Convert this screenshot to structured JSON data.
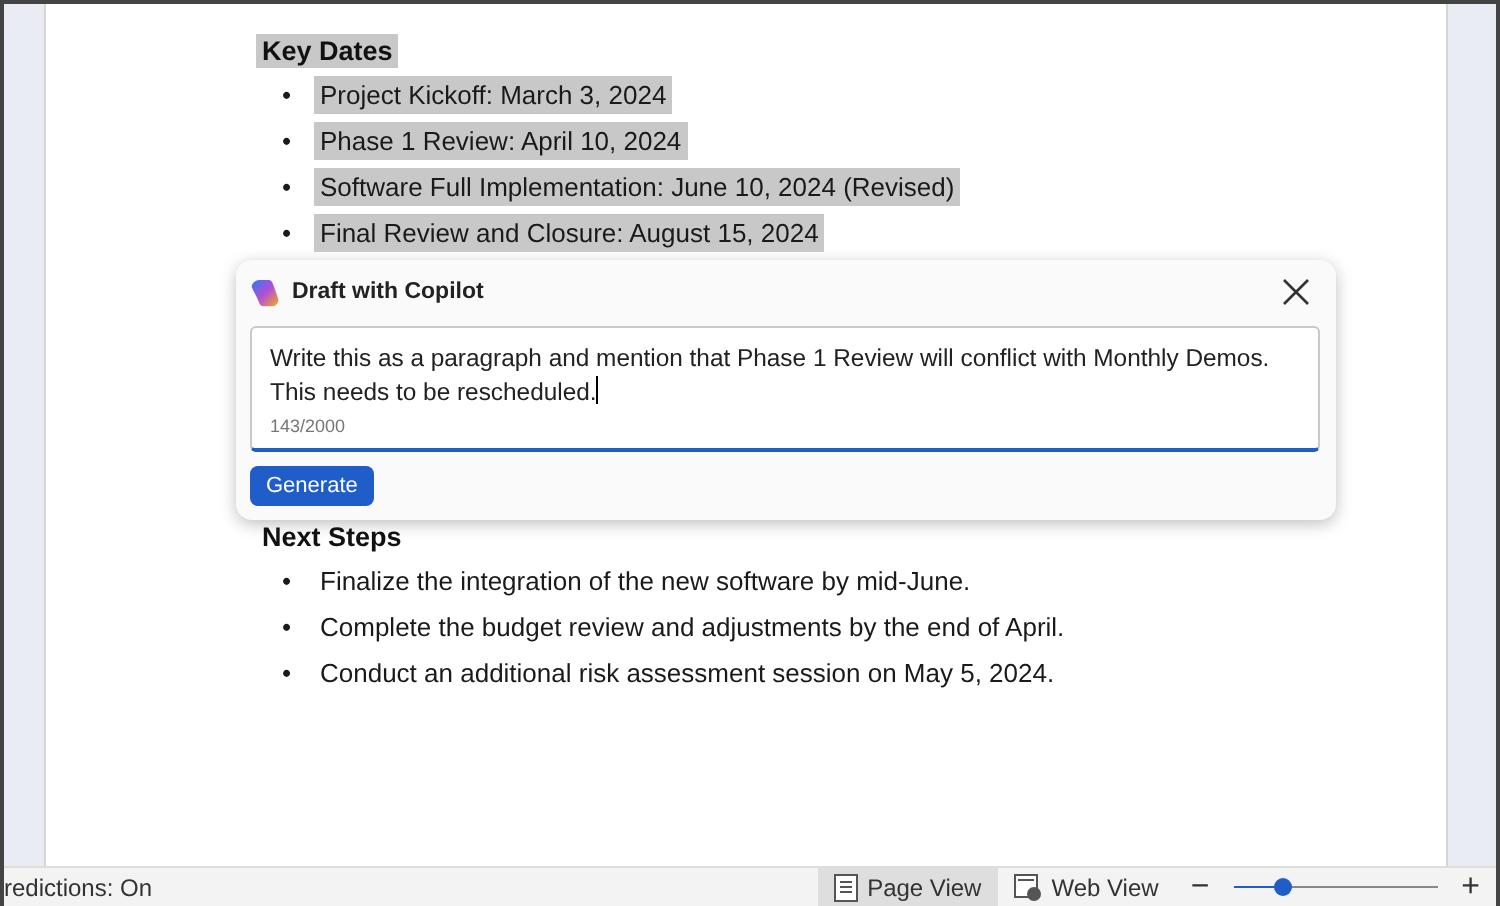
{
  "sections": [
    {
      "heading": "Key Dates",
      "selected": true,
      "items": [
        {
          "bullet": "•",
          "text": "Project Kickoff: March 3, 2024",
          "selected": true
        },
        {
          "bullet": "•",
          "text": "Phase 1 Review: April 10, 2024",
          "selected": true
        },
        {
          "bullet": "•",
          "text": "Software Full Implementation: June 10, 2024 (Revised)",
          "selected": true
        },
        {
          "bullet": "•",
          "text": "Final Review and Closure: August 15, 2024",
          "selected": true
        }
      ]
    },
    {
      "heading": "Next Steps",
      "selected": false,
      "items": [
        {
          "bullet": "•",
          "text": "Finalize the integration of the new software by mid-June.",
          "selected": false
        },
        {
          "bullet": "•",
          "text": "Complete the budget review and adjustments by the end of April.",
          "selected": false
        },
        {
          "bullet": "•",
          "text": "Conduct an additional risk assessment session on May 5, 2024.",
          "selected": false
        }
      ]
    }
  ],
  "copilot_dialog": {
    "title": "Draft with Copilot",
    "prompt": "Write this as a paragraph and mention that Phase 1 Review will conflict with Monthly Demos. This needs to be rescheduled.",
    "counter": "143/2000",
    "button": "Generate"
  },
  "status_bar": {
    "predictions": "redictions: On",
    "views": [
      {
        "label": "Page View",
        "kind": "page",
        "selected": true
      },
      {
        "label": "Web View",
        "kind": "web",
        "selected": false
      }
    ],
    "zoom_out": "−",
    "zoom_in": "+",
    "zoom": {
      "level": 0.24
    }
  }
}
